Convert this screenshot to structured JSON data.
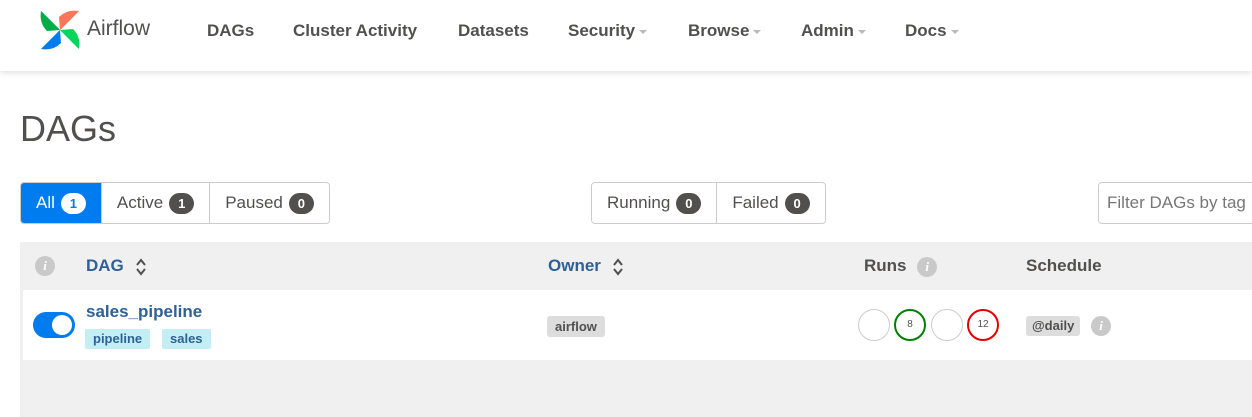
{
  "brand": {
    "name": "Airflow"
  },
  "nav": {
    "items": [
      {
        "label": "DAGs",
        "dropdown": false
      },
      {
        "label": "Cluster Activity",
        "dropdown": false
      },
      {
        "label": "Datasets",
        "dropdown": false
      },
      {
        "label": "Security",
        "dropdown": true
      },
      {
        "label": "Browse",
        "dropdown": true
      },
      {
        "label": "Admin",
        "dropdown": true
      },
      {
        "label": "Docs",
        "dropdown": true
      }
    ]
  },
  "page": {
    "title": "DAGs"
  },
  "status_filters": [
    {
      "label": "All",
      "count": "1",
      "active": true
    },
    {
      "label": "Active",
      "count": "1",
      "active": false
    },
    {
      "label": "Paused",
      "count": "0",
      "active": false
    }
  ],
  "run_filters": [
    {
      "label": "Running",
      "count": "0"
    },
    {
      "label": "Failed",
      "count": "0"
    }
  ],
  "tag_filter": {
    "placeholder": "Filter DAGs by tag"
  },
  "table": {
    "headers": {
      "info": "i",
      "dag": "DAG",
      "owner": "Owner",
      "runs": "Runs",
      "schedule": "Schedule"
    },
    "rows": [
      {
        "enabled": true,
        "dag_id": "sales_pipeline",
        "tags": [
          "pipeline",
          "sales"
        ],
        "owner": "airflow",
        "runs": [
          {
            "state": "queued",
            "count": ""
          },
          {
            "state": "success",
            "count": "8"
          },
          {
            "state": "running",
            "count": ""
          },
          {
            "state": "failed",
            "count": "12"
          }
        ],
        "schedule": "@daily",
        "schedule_info": "i"
      }
    ]
  },
  "colors": {
    "accent": "#017cee",
    "link": "#2e6196",
    "success": "#008000",
    "failed": "#e00000",
    "tag_bg": "#c3eef4"
  }
}
